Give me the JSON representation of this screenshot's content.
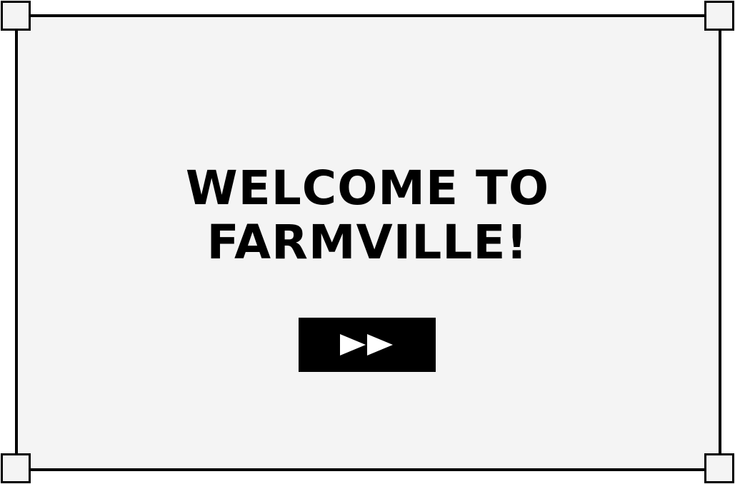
{
  "screen": {
    "title_line1": "WELCOME TO",
    "title_line2": "FARMVILLE!"
  },
  "button": {
    "icon": "fast-forward-icon",
    "color": "#000000",
    "icon_color": "#ffffff"
  },
  "colors": {
    "background": "#f4f4f4",
    "border": "#000000",
    "text": "#000000"
  }
}
